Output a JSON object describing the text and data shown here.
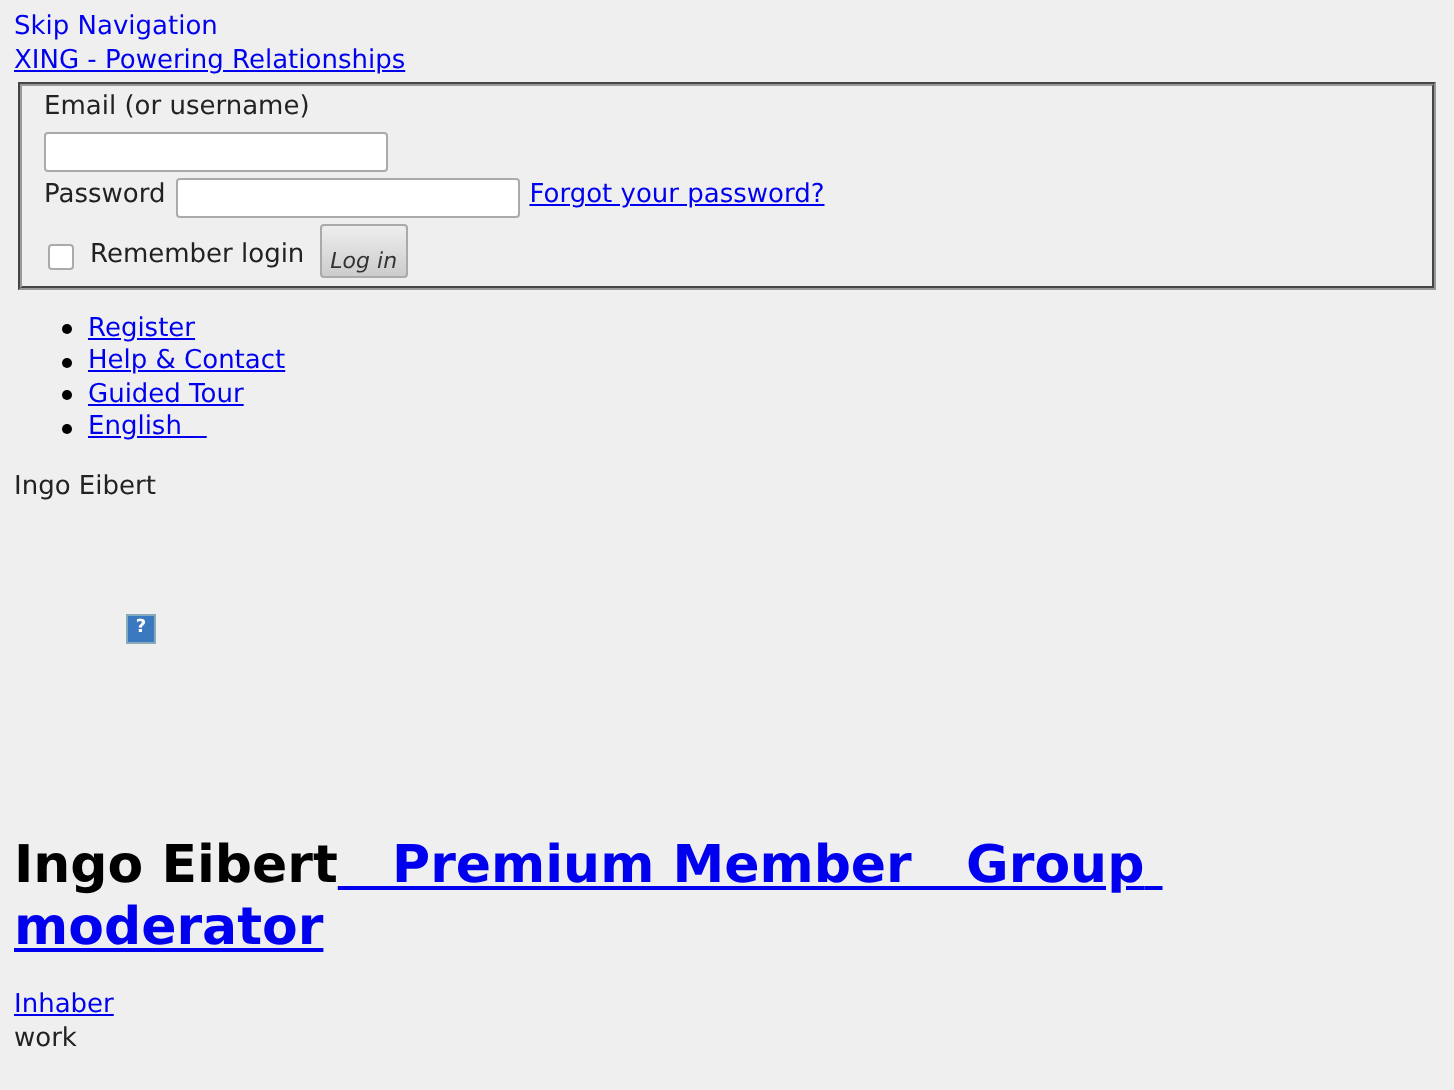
{
  "skip_link": "Skip Navigation",
  "logo_link": "XING - Powering Relationships",
  "login": {
    "email_label": "Email (or username)",
    "password_label": "Password",
    "forgot_link": "Forgot your password?",
    "remember": {
      "label": "Remember login",
      "checked": false
    },
    "button": "Log in"
  },
  "nav": [
    "Register",
    "Help & Contact",
    "Guided Tour",
    "English   "
  ],
  "profile_name_small": "Ingo Eibert",
  "help_icon": "?",
  "profile": {
    "name": "Ingo Eibert",
    "badge_link": "   Premium Member   Group moderator",
    "role_link": "Inhaber",
    "role_label": "work"
  }
}
